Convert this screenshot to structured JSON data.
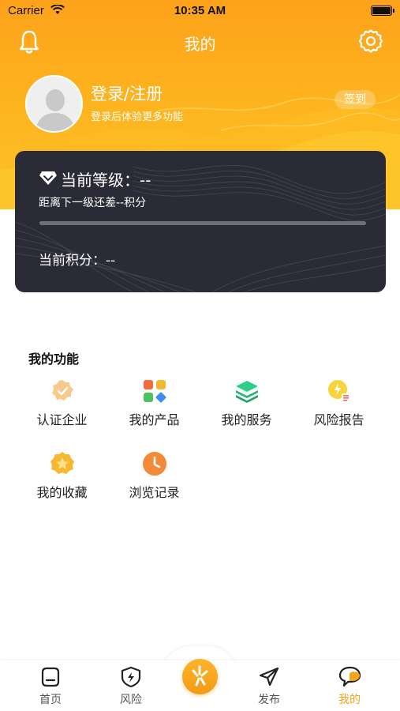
{
  "status_bar": {
    "carrier": "Carrier",
    "time": "10:35 AM"
  },
  "header": {
    "title": "我的",
    "login_title": "登录/注册",
    "login_subtitle": "登录后体验更多功能",
    "checkin_label": "签到"
  },
  "level_card": {
    "level_text": "当前等级：--",
    "next_level_text": "距离下一级还差--积分",
    "points_text": "当前积分：--",
    "progress": 0
  },
  "functions": {
    "title": "我的功能",
    "items": [
      {
        "label": "认证企业",
        "icon": "certified-badge-icon"
      },
      {
        "label": "我的产品",
        "icon": "product-grid-icon"
      },
      {
        "label": "我的服务",
        "icon": "service-layers-icon"
      },
      {
        "label": "风险报告",
        "icon": "risk-report-icon"
      },
      {
        "label": "我的收藏",
        "icon": "favorite-star-icon"
      },
      {
        "label": "浏览记录",
        "icon": "history-clock-icon"
      }
    ]
  },
  "tab_bar": {
    "items": [
      {
        "label": "首页",
        "icon": "home-icon"
      },
      {
        "label": "风险",
        "icon": "shield-bolt-icon"
      },
      {
        "label": "",
        "icon": "center-burst-icon"
      },
      {
        "label": "发布",
        "icon": "paper-plane-icon"
      },
      {
        "label": "我的",
        "icon": "profile-chat-icon"
      }
    ],
    "active_index": 4
  },
  "colors": {
    "accent": "#f5a118",
    "header_top": "#fda21a",
    "header_bottom": "#fec326",
    "card_bg": "#2a2b36"
  }
}
